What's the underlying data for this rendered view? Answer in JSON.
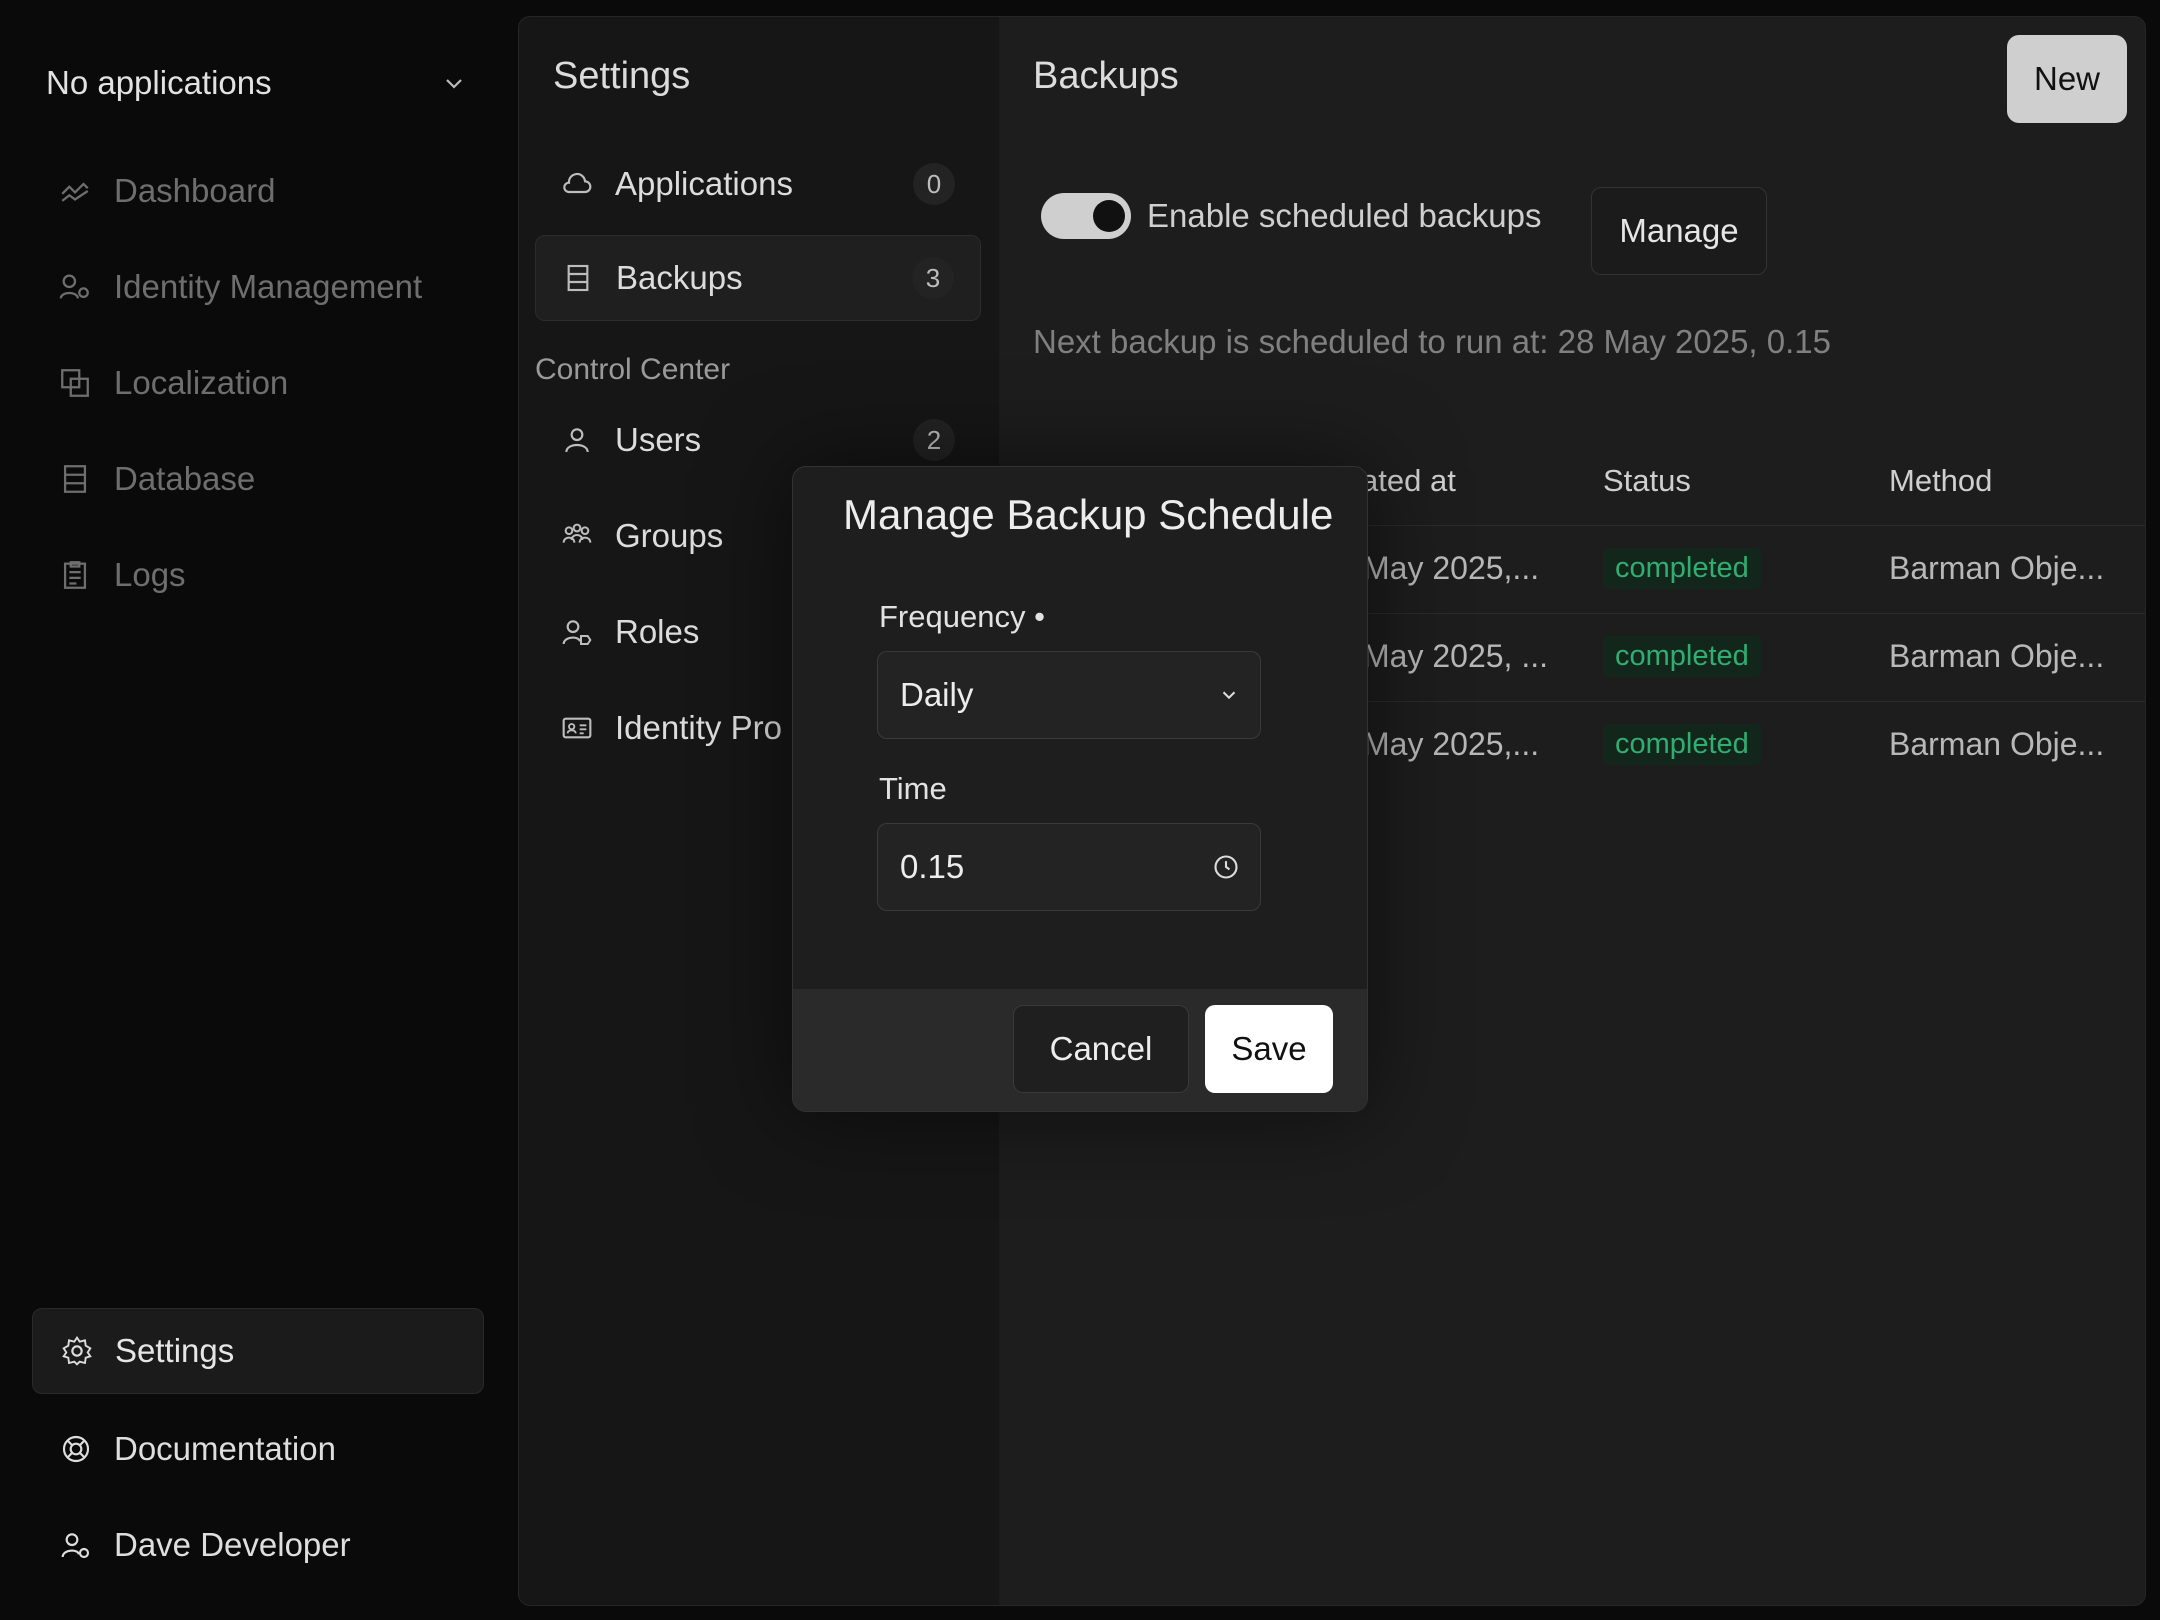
{
  "sidebar": {
    "app_selector": "No applications",
    "nav": [
      {
        "label": "Dashboard",
        "icon": "chart-line-icon"
      },
      {
        "label": "Identity Management",
        "icon": "users-gear-icon"
      },
      {
        "label": "Localization",
        "icon": "translate-icon"
      },
      {
        "label": "Database",
        "icon": "database-icon"
      },
      {
        "label": "Logs",
        "icon": "clipboard-icon"
      }
    ],
    "bottom": {
      "settings": "Settings",
      "documentation": "Documentation",
      "user": "Dave Developer"
    }
  },
  "settings_panel": {
    "title": "Settings",
    "items": [
      {
        "label": "Applications",
        "count": "0",
        "icon": "cloud-icon"
      },
      {
        "label": "Backups",
        "count": "3",
        "icon": "server-icon"
      }
    ],
    "section": "Control Center",
    "control_items": [
      {
        "label": "Users",
        "count": "2",
        "icon": "user-icon"
      },
      {
        "label": "Groups",
        "icon": "group-icon"
      },
      {
        "label": "Roles",
        "icon": "user-tag-icon"
      },
      {
        "label": "Identity Pro",
        "icon": "id-card-icon"
      }
    ]
  },
  "backups": {
    "title": "Backups",
    "new_label": "New",
    "toggle_label": "Enable scheduled backups",
    "toggle_on": true,
    "manage_label": "Manage",
    "next_backup": "Next backup is scheduled to run at: 28 May 2025, 0.15",
    "columns": {
      "created": "ated at",
      "status": "Status",
      "method": "Method"
    },
    "rows": [
      {
        "created": "May 2025,...",
        "status": "completed",
        "method": "Barman Obje..."
      },
      {
        "created": "May 2025, ...",
        "status": "completed",
        "method": "Barman Obje..."
      },
      {
        "created": "May 2025,...",
        "status": "completed",
        "method": "Barman Obje..."
      }
    ]
  },
  "modal": {
    "title": "Manage Backup Schedule",
    "frequency_label": "Frequency",
    "required_mark": "•",
    "frequency_value": "Daily",
    "time_label": "Time",
    "time_value": "0.15",
    "cancel_label": "Cancel",
    "save_label": "Save"
  },
  "colors": {
    "status_green": "#2fae71",
    "badge_bg": "#13261c"
  }
}
